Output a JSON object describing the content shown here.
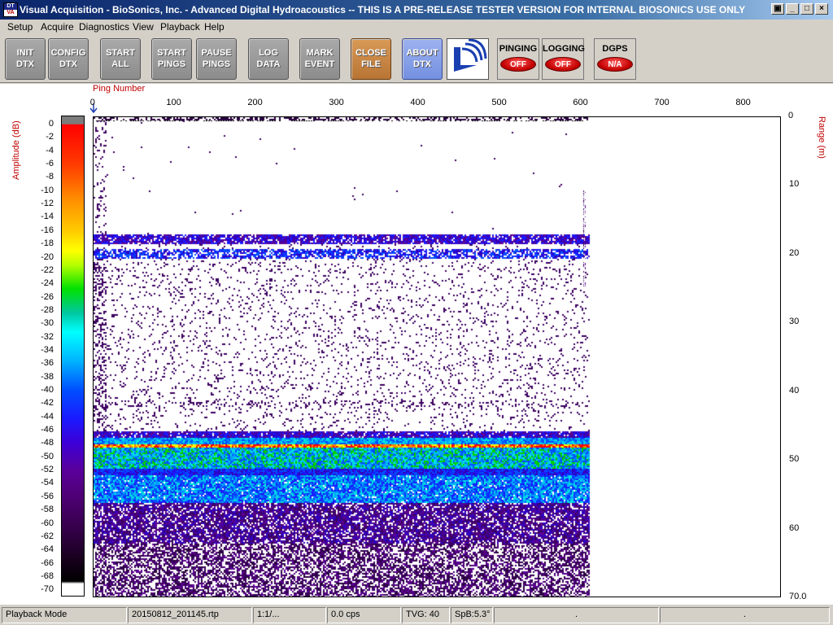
{
  "window": {
    "title": "Visual Acquisition  -  BioSonics, Inc.  -  Advanced Digital Hydroacoustics  -- THIS IS A PRE-RELEASE TESTER VERSION FOR INTERNAL BIOSONICS USE ONLY",
    "icon_text_top": "DT",
    "icon_text_bottom": "VA",
    "buttons": {
      "restore": "▣",
      "minimize": "_",
      "maximize": "□",
      "close": "×"
    }
  },
  "menu": [
    "Setup",
    "Acquire",
    "Diagnostics",
    "View",
    "Playback",
    "Help"
  ],
  "toolbar": {
    "buttons": [
      {
        "id": "init",
        "label": "INIT\nDTX"
      },
      {
        "id": "config",
        "label": "CONFIG\nDTX"
      },
      {
        "id": "start-all",
        "label": "START\nALL"
      },
      {
        "id": "start-pings",
        "label": "START\nPINGS"
      },
      {
        "id": "pause-pings",
        "label": "PAUSE\nPINGS"
      },
      {
        "id": "log-data",
        "label": "LOG\nDATA"
      },
      {
        "id": "mark-event",
        "label": "MARK\nEVENT"
      },
      {
        "id": "close-file",
        "label": "CLOSE\nFILE"
      },
      {
        "id": "about-dtx",
        "label": "ABOUT\nDTX"
      }
    ],
    "indicators": [
      {
        "id": "pinging",
        "label": "PINGING",
        "state": "OFF"
      },
      {
        "id": "logging",
        "label": "LOGGING",
        "state": "OFF"
      },
      {
        "id": "dgps",
        "label": "DGPS",
        "state": "N/A"
      }
    ]
  },
  "plot": {
    "x_axis_label": "Ping Number",
    "x_ticks": [
      "0",
      "100",
      "200",
      "300",
      "400",
      "500",
      "600",
      "700",
      "800"
    ],
    "amplitude_label": "Amplitude (dB)",
    "amplitude_ticks": [
      "0",
      "-2",
      "-4",
      "-6",
      "-8",
      "-10",
      "-12",
      "-14",
      "-16",
      "-18",
      "-20",
      "-22",
      "-24",
      "-26",
      "-28",
      "-30",
      "-32",
      "-34",
      "-36",
      "-38",
      "-40",
      "-42",
      "-44",
      "-46",
      "-48",
      "-50",
      "-52",
      "-54",
      "-56",
      "-58",
      "-60",
      "-62",
      "-64",
      "-66",
      "-68",
      "-70"
    ],
    "range_label": "Range (m)",
    "range_ticks": [
      "0",
      "10",
      "20",
      "30",
      "40",
      "50",
      "60",
      "70.0"
    ],
    "accent_color": "#c00000"
  },
  "statusbar": {
    "mode": "Playback Mode",
    "file": "20150812_201145.rtp",
    "ratio": "1:1/...",
    "rate": "0.0 cps",
    "tvg": "TVG: 40",
    "spb": "SpB:5.3°",
    "cell7": ".",
    "cell8": "."
  }
}
